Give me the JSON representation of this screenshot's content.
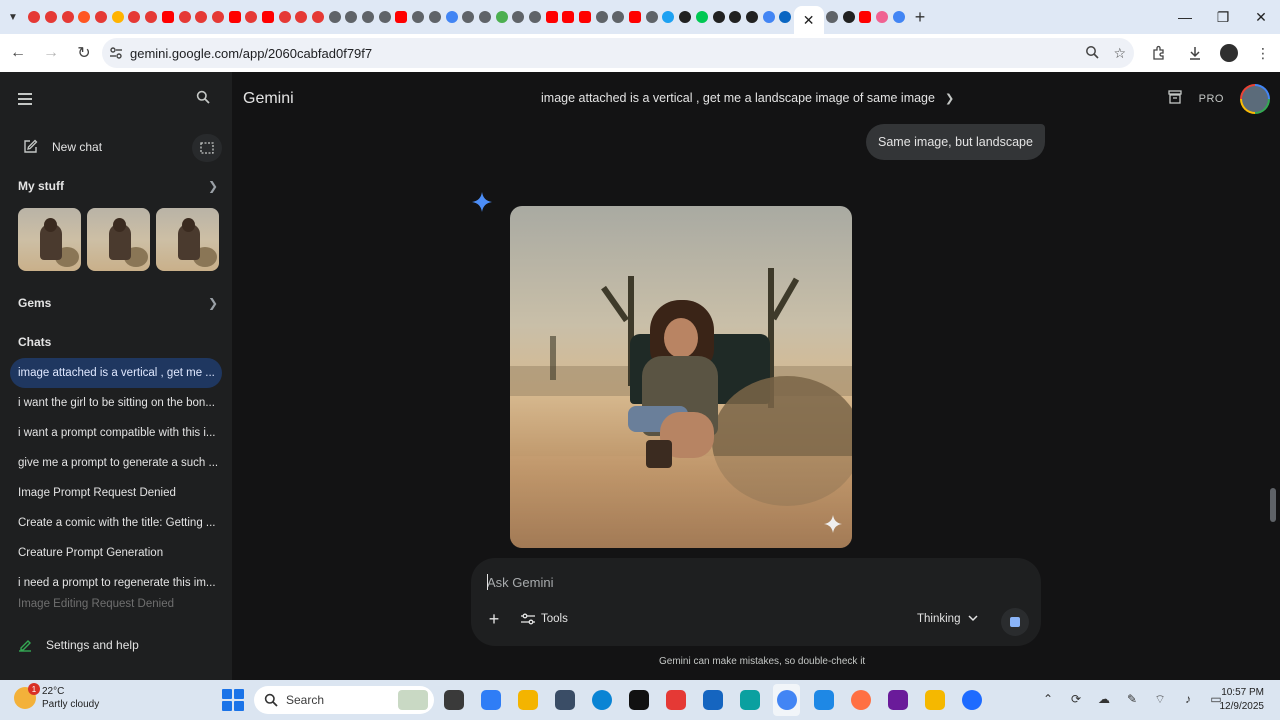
{
  "browser": {
    "url": "gemini.google.com/app/2060cabfad0f79f7",
    "active_tab_close": "✕",
    "new_tab": "+",
    "tab_favicon_colors": [
      "#e53935",
      "#e53935",
      "#e53935",
      "#ff5722",
      "#e53935",
      "#ffb300",
      "#e53935",
      "#e53935",
      "#ff0000",
      "#e53935",
      "#e53935",
      "#e53935",
      "#ff0000",
      "#e53935",
      "#ff0000",
      "#e53935",
      "#e53935",
      "#e53935",
      "#5f6368",
      "#5f6368",
      "#5f6368",
      "#5f6368",
      "#ff0000",
      "#5f6368",
      "#5f6368",
      "#4285f4",
      "#5f6368",
      "#5f6368",
      "#4caf50",
      "#5f6368",
      "#5f6368",
      "#ff0000",
      "#ff0000",
      "#ff0000",
      "#5f6368",
      "#5f6368",
      "#ff0000",
      "#5f6368",
      "#1da1f2",
      "#212121",
      "#00c853",
      "#212121",
      "#212121",
      "#212121",
      "#4285f4",
      "#0a66c2"
    ],
    "tab_favicon_colors_right": [
      "#5f6368",
      "#212121",
      "#ff0000",
      "#f06292",
      "#4285f4"
    ]
  },
  "sidebar": {
    "new_chat": "New chat",
    "my_stuff": "My stuff",
    "gems": "Gems",
    "chats_heading": "Chats",
    "chats": [
      "image attached is a vertical , get me ...",
      "i want the girl to be sitting on the bon...",
      "i want a prompt compatible with this i...",
      "give me a prompt to generate a such ...",
      "Image Prompt Request Denied",
      "Create a comic with the title: Getting ...",
      "Creature Prompt Generation",
      "i need a prompt to regenerate this im...",
      "Image Editing Request Denied"
    ],
    "settings": "Settings and help"
  },
  "main": {
    "brand": "Gemini",
    "conversation_title": "image attached is a vertical , get me a landscape image of same image",
    "pro_badge": "PRO",
    "user_message": "Same image, but landscape",
    "composer": {
      "placeholder": "Ask Gemini",
      "tools": "Tools",
      "mode": "Thinking"
    },
    "disclaimer": "Gemini can make mistakes, so double-check it"
  },
  "taskbar": {
    "weather_temp": "22°C",
    "weather_desc": "Partly cloudy",
    "weather_badge": "1",
    "search": "Search",
    "time": "10:57 PM",
    "date": "12/9/2025",
    "app_colors": [
      "#3a3a3a",
      "#2f7df6",
      "#f4b400",
      "#3a4d66",
      "#0a84d4",
      "#111111",
      "#e53935",
      "#1565c0",
      "#0aa0a0",
      "#4285f4",
      "#1e88e5",
      "#ff7043",
      "#6a1b9a",
      "#f5b800",
      "#1e6bff"
    ]
  }
}
